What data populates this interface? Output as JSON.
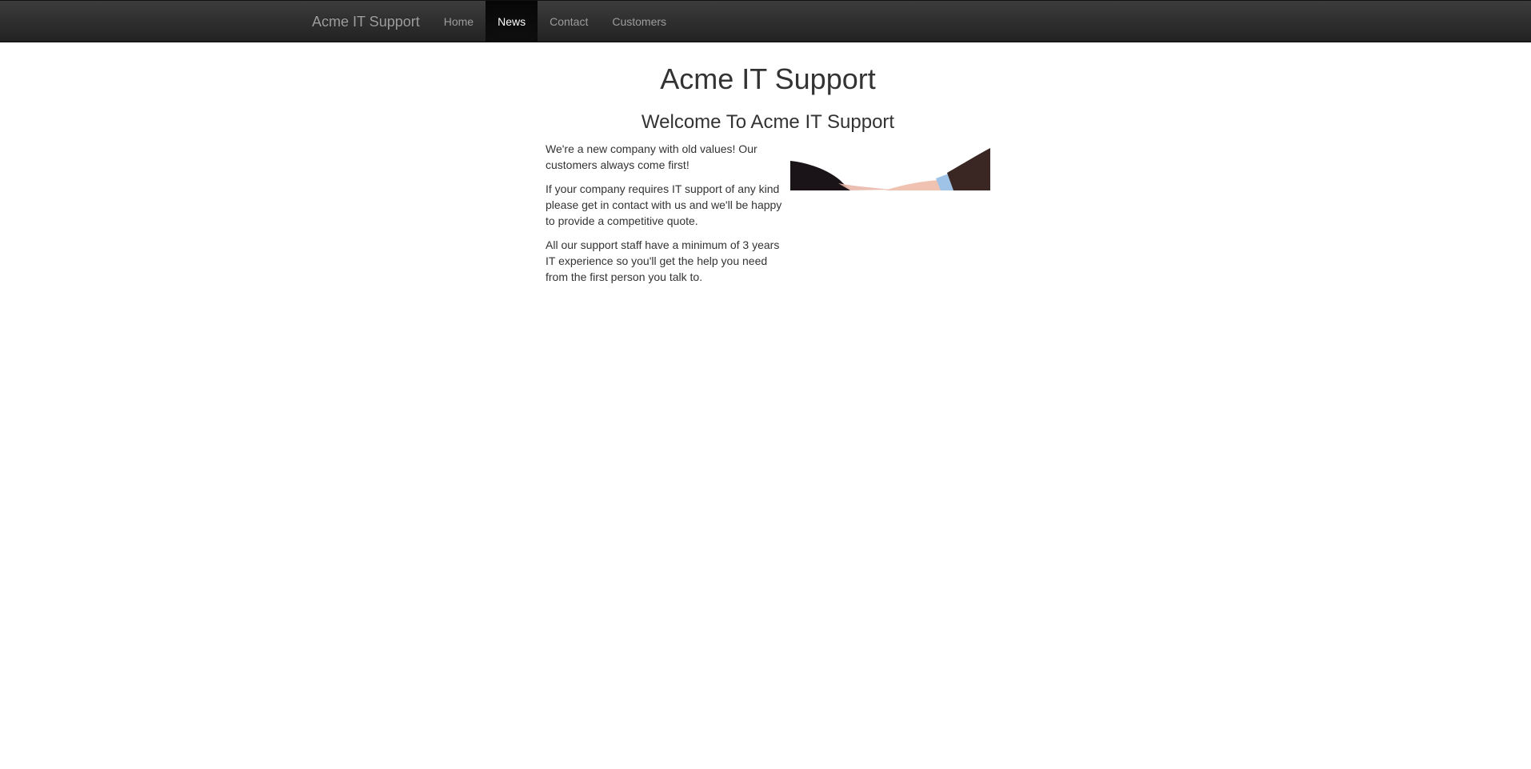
{
  "navbar": {
    "brand": "Acme IT Support",
    "links": [
      {
        "label": "Home",
        "active": false
      },
      {
        "label": "News",
        "active": true
      },
      {
        "label": "Contact",
        "active": false
      },
      {
        "label": "Customers",
        "active": false
      }
    ]
  },
  "main": {
    "title": "Acme IT Support",
    "subtitle": "Welcome To Acme IT Support",
    "paragraphs": [
      "We're a new company with old values! Our customers always come first!",
      "If your company requires IT support of any kind please get in contact with us and we'll be happy to provide a competitive quote.",
      "All our support staff have a minimum of 3 years IT experience so you'll get the help you need from the first person you talk to."
    ],
    "image": {
      "icon": "handshake-image",
      "colors": {
        "left_sleeve": "#1a1418",
        "right_sleeve": "#3a2622",
        "cuff": "#9ec3e6",
        "skin": "#e8b8a8"
      }
    }
  }
}
